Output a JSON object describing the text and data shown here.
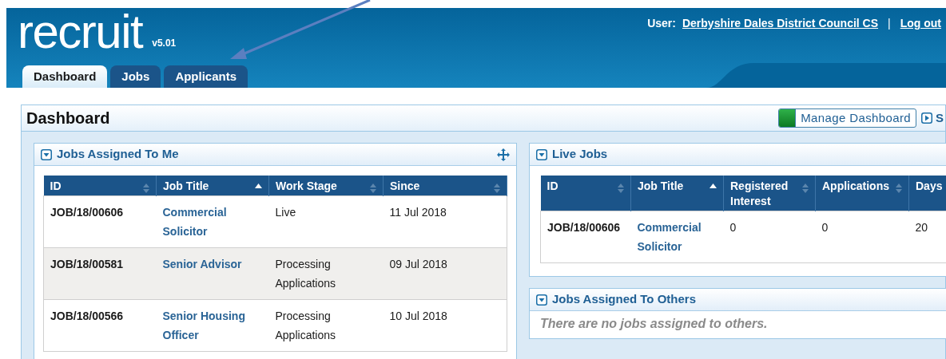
{
  "header": {
    "logo": "recruit",
    "version": "v5.01",
    "user_label": "User:",
    "user_name": "Derbyshire Dales District Council CS",
    "separator": "|",
    "logout": "Log out"
  },
  "tabs": [
    {
      "label": "Dashboard",
      "selected": true
    },
    {
      "label": "Jobs",
      "selected": false
    },
    {
      "label": "Applicants",
      "selected": false
    }
  ],
  "dashboard": {
    "title": "Dashboard",
    "manage_button": "Manage Dashboard",
    "cut_link": "S"
  },
  "jobs_assigned_to_me": {
    "title": "Jobs Assigned To Me",
    "columns": [
      {
        "label": "ID",
        "sorted": false
      },
      {
        "label": "Job Title",
        "sorted": true
      },
      {
        "label": "Work Stage",
        "sorted": false
      },
      {
        "label": "Since",
        "sorted": false
      }
    ],
    "rows": [
      [
        "JOB/18/00606",
        "Commercial Solicitor",
        "Live",
        "11 Jul 2018"
      ],
      [
        "JOB/18/00581",
        "Senior Advisor",
        "Processing Applications",
        "09 Jul 2018"
      ],
      [
        "JOB/18/00566",
        "Senior Housing Officer",
        "Processing Applications",
        "10 Jul 2018"
      ]
    ]
  },
  "live_jobs": {
    "title": "Live Jobs",
    "columns": [
      {
        "label": "ID",
        "sorted": false
      },
      {
        "label": "Job Title",
        "sorted": true
      },
      {
        "label": "Registered Interest",
        "sorted": false
      },
      {
        "label": "Applications",
        "sorted": false
      },
      {
        "label": "Days"
      }
    ],
    "rows": [
      [
        "JOB/18/00606",
        "Commercial Solicitor",
        "0",
        "0",
        "20"
      ]
    ]
  },
  "jobs_assigned_to_others": {
    "title": "Jobs Assigned To Others",
    "empty_message": "There are no jobs assigned to others."
  }
}
